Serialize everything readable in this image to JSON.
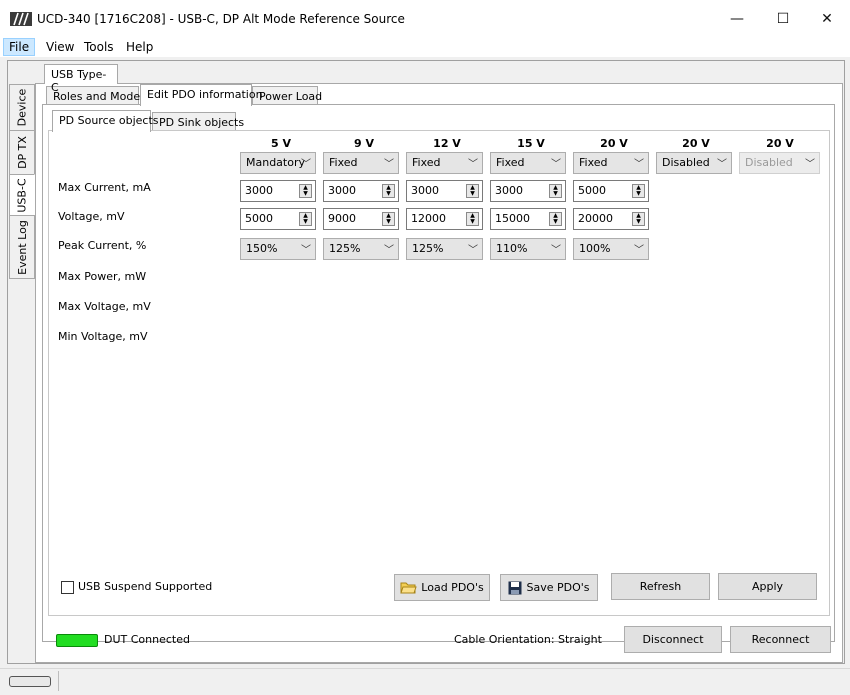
{
  "window": {
    "title": "UCD-340 [1716C208] - USB-C, DP Alt Mode Reference Source",
    "minimize_glyph": "—",
    "maximize_glyph": "☐",
    "close_glyph": "✕"
  },
  "menu": [
    "File",
    "View",
    "Tools",
    "Help"
  ],
  "side_tabs": [
    "Device",
    "DP TX",
    "USB-C",
    "Event Log"
  ],
  "top_tab": "USB Type-C",
  "sub_tabs": [
    "Roles and Modes",
    "Edit PDO information",
    "Power Load"
  ],
  "pdo_tabs": [
    "PD Source objects",
    "PD Sink objects"
  ],
  "columns": [
    "5 V",
    "9 V",
    "12 V",
    "15 V",
    "20 V",
    "20 V",
    "20 V"
  ],
  "pdo_types": [
    "Mandatory",
    "Fixed",
    "Fixed",
    "Fixed",
    "Fixed",
    "Disabled",
    "Disabled"
  ],
  "row_labels": [
    "Max Current, mA",
    "Voltage, mV",
    "Peak Current, %",
    "Max Power, mW",
    "Max Voltage, mV",
    "Min Voltage, mV"
  ],
  "max_current": [
    "3000",
    "3000",
    "3000",
    "3000",
    "5000"
  ],
  "voltage": [
    "5000",
    "9000",
    "12000",
    "15000",
    "20000"
  ],
  "peak_current": [
    "150%",
    "125%",
    "125%",
    "110%",
    "100%"
  ],
  "usb_suspend_label": "USB Suspend Supported",
  "usb_suspend_checked": false,
  "buttons": {
    "load": "Load PDO's",
    "save": "Save PDO's",
    "refresh": "Refresh",
    "apply": "Apply",
    "disconnect": "Disconnect",
    "reconnect": "Reconnect"
  },
  "status": {
    "dut": "DUT Connected",
    "cable": "Cable Orientation: Straight",
    "led_color": "#22dd22"
  },
  "icons": {
    "logo": "app-logo-icon",
    "folder": "folder-icon",
    "save": "floppy-disk-icon",
    "dropdown": "chevron-down-icon",
    "spin": "spin-arrows-icon"
  }
}
